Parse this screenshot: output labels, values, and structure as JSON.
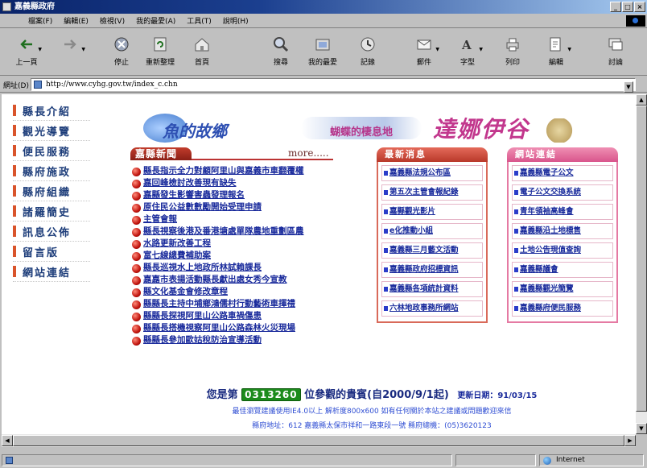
{
  "window": {
    "title": "嘉義縣政府",
    "buttons": [
      "_",
      "□",
      "×"
    ]
  },
  "menu": [
    "檔案(F)",
    "編輯(E)",
    "檢視(V)",
    "我的最愛(A)",
    "工具(T)",
    "說明(H)"
  ],
  "toolbar": [
    {
      "label": "上一頁",
      "icon": "back-arrow-icon"
    },
    {
      "label": "",
      "icon": "forward-arrow-icon"
    },
    {
      "label": "停止",
      "icon": "stop-icon"
    },
    {
      "label": "重新整理",
      "icon": "refresh-icon"
    },
    {
      "label": "首頁",
      "icon": "home-icon"
    },
    {
      "label": "搜尋",
      "icon": "search-icon"
    },
    {
      "label": "我的最愛",
      "icon": "favorites-icon"
    },
    {
      "label": "記錄",
      "icon": "history-icon"
    },
    {
      "label": "郵件",
      "icon": "mail-icon"
    },
    {
      "label": "字型",
      "icon": "font-icon"
    },
    {
      "label": "列印",
      "icon": "print-icon"
    },
    {
      "label": "編輯",
      "icon": "edit-icon"
    },
    {
      "label": "討論",
      "icon": "discuss-icon"
    }
  ],
  "address": {
    "label": "網址(D)",
    "url": "http://www.cyhg.gov.tw/index_c.chn"
  },
  "nav": [
    "縣長介紹",
    "觀光導覽",
    "便民服務",
    "縣府施政",
    "縣府組織",
    "諸羅簡史",
    "訊息公佈",
    "留言版",
    "網站連結"
  ],
  "banner": {
    "part1": "魚的故鄉",
    "part2": "蝴蝶的棲息地",
    "part3": "達娜伊谷"
  },
  "news": {
    "title": "嘉縣新聞",
    "more": "more.....",
    "items": [
      "縣長指示全力對顧阿里山與嘉義市車翻覆權",
      "嘉回峰檢討改善現有缺失",
      "嘉縣發生影響害蟲發理報名",
      "原住民公益數數勵開始受理申請",
      "主管會報",
      "縣長視察後港及番港塘處單隊農地重劃區農",
      "水路更新改善工程",
      "富七線總費補助案",
      "縣長巡視水上地政所林試賴課長",
      "嘉嘉市表揚活動縣長獻出處女秀今宣教",
      "縣文化基金會修改章程",
      "縣縣長主持中埔鄉鴻儒村行動藝術車揮禮",
      "縣縣長探視阿里山公路車禍傷患",
      "縣縣長搭機視察阿里山公路森林火災現場",
      "縣縣長參加歐姑稅防治宣導活動"
    ]
  },
  "latest": {
    "title": "最新消息",
    "items": [
      "嘉義縣法規公布區",
      "第五次主管會報紀錄",
      "嘉縣觀光影片",
      "e化推動小組",
      "嘉義縣三月藝文活動",
      "嘉義縣政府招標資訊",
      "嘉義縣各項統計資料",
      "六林地政事務所網站"
    ]
  },
  "links": {
    "title": "網站連結",
    "items": [
      "嘉義縣電子公文",
      "電子公文交換系統",
      "青年領袖高峰會",
      "嘉義縣沿土地標售",
      "土地公告現值查詢",
      "嘉義縣議會",
      "嘉義縣觀光簡覽",
      "嘉義縣府便民服務"
    ]
  },
  "footer": {
    "prefix": "您是第",
    "counter": "0313260",
    "suffix": "位參觀的貴賓(自2000/9/1起)",
    "update": "更新日期：91/03/15",
    "line2": "最佳瀏覽建議使用IE4.0以上 解析度800x600 如有任何關於本站之建議或問題歡迎來信",
    "line3": "縣府地址：612 嘉義縣太保市祥和一路東段一號 縣府總機：(05)3620123"
  },
  "status": {
    "zone": "Internet"
  },
  "colors": {
    "accent_red": "#c23d2c",
    "link_blue": "#1a2b9c",
    "pink_box": "#d9558c"
  }
}
